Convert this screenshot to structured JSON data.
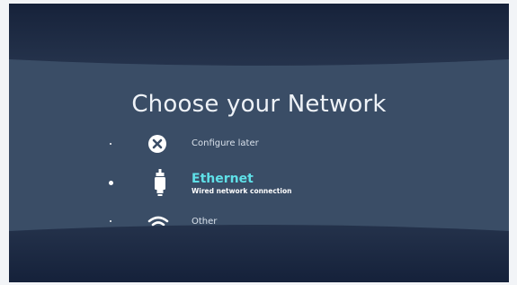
{
  "page": {
    "title": "Choose your Network"
  },
  "options": [
    {
      "icon": "close-circle-icon",
      "label": "Configure later",
      "selected": false
    },
    {
      "icon": "ethernet-plug-icon",
      "label": "Ethernet",
      "description": "Wired network connection",
      "selected": true
    },
    {
      "icon": "wifi-icon",
      "label": "Other",
      "selected": false
    }
  ],
  "colors": {
    "background": "#3a4d66",
    "shade": "#1c2940",
    "accent": "#5fe0e8",
    "text": "#eef2f7"
  }
}
